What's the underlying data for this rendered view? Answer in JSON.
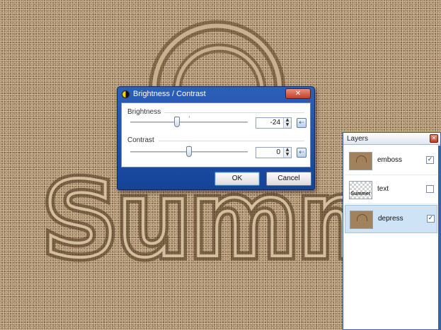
{
  "dialog": {
    "title": "Brightness / Contrast",
    "close_glyph": "✕",
    "brightness": {
      "label": "Brightness",
      "value": "-24",
      "slider_fraction": 0.4
    },
    "contrast": {
      "label": "Contrast",
      "value": "0",
      "slider_fraction": 0.5
    },
    "ok_label": "OK",
    "cancel_label": "Cancel",
    "spin_up": "▲",
    "spin_down": "▼",
    "reset_glyph": "⇠"
  },
  "layers_panel": {
    "title": "Layers",
    "close_glyph": "✕",
    "items": [
      {
        "name": "emboss",
        "visible": true,
        "thumb": "sand",
        "thumb_text": ""
      },
      {
        "name": "text",
        "visible": false,
        "thumb": "checker",
        "thumb_text": "Summer"
      },
      {
        "name": "depress",
        "visible": true,
        "thumb": "sand",
        "thumb_text": "",
        "selected": true
      }
    ]
  },
  "canvas": {
    "sand_text": "Summe"
  },
  "colors": {
    "dialog_frame": "#15439a",
    "sand": "#a88a66",
    "selection": "#cfe3f7"
  }
}
